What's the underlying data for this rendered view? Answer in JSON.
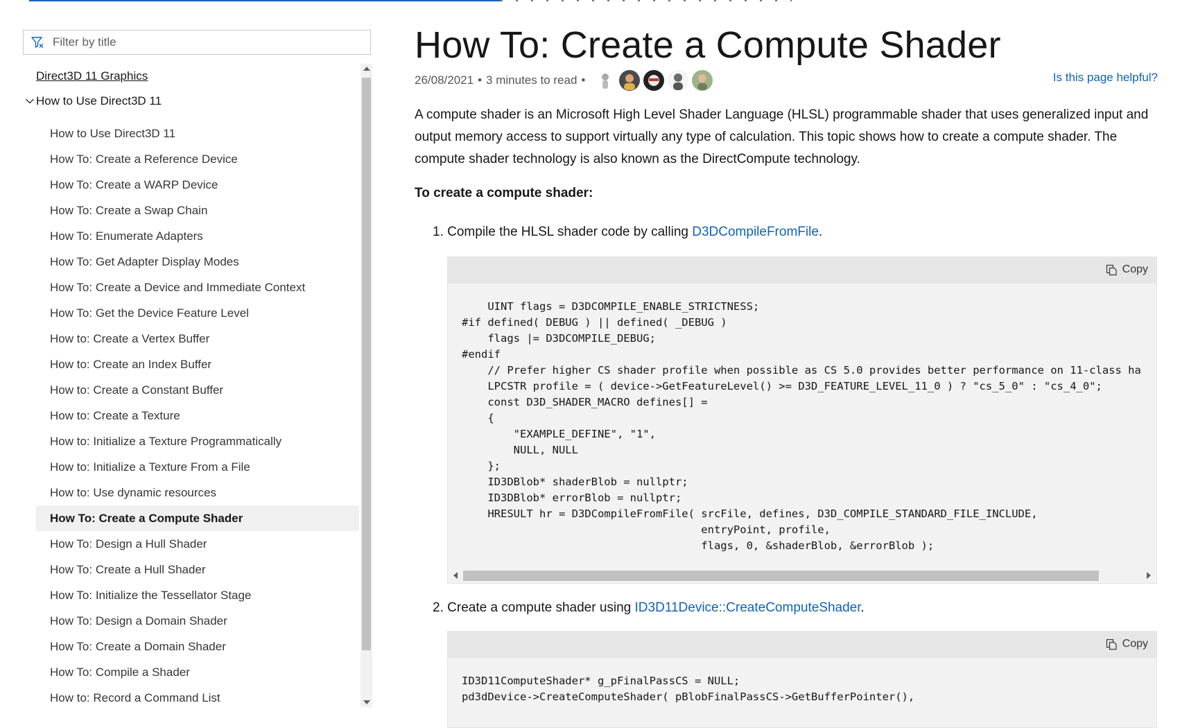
{
  "filter": {
    "placeholder": "Filter by title"
  },
  "toc": {
    "root": "Direct3D 11 Graphics",
    "group": "How to Use Direct3D 11",
    "items": [
      "How to Use Direct3D 11",
      "How To: Create a Reference Device",
      "How To: Create a WARP Device",
      "How To: Create a Swap Chain",
      "How To: Enumerate Adapters",
      "How To: Get Adapter Display Modes",
      "How To: Create a Device and Immediate Context",
      "How To: Get the Device Feature Level",
      "How to: Create a Vertex Buffer",
      "How to: Create an Index Buffer",
      "How to: Create a Constant Buffer",
      "How to: Create a Texture",
      "How to: Initialize a Texture Programmatically",
      "How to: Initialize a Texture From a File",
      "How to: Use dynamic resources",
      "How To: Create a Compute Shader",
      "How To: Design a Hull Shader",
      "How To: Create a Hull Shader",
      "How To: Initialize the Tessellator Stage",
      "How To: Design a Domain Shader",
      "How To: Create a Domain Shader",
      "How To: Compile a Shader",
      "How to: Record a Command List"
    ],
    "active_index": 15
  },
  "article": {
    "title": "How To: Create a Compute Shader",
    "date": "26/08/2021",
    "read_time": "3 minutes to read",
    "bullet": "•",
    "helpful": "Is this page helpful?",
    "intro": "A compute shader is an Microsoft High Level Shader Language (HLSL) programmable shader that uses generalized input and output memory access to support virtually any type of calculation. This topic shows how to create a compute shader. The compute shader technology is also known as the DirectCompute technology.",
    "procedure_heading": "To create a compute shader:",
    "steps": [
      {
        "number": "1.",
        "text": "Compile the HLSL shader code by calling ",
        "link": "D3DCompileFromFile",
        "after": "."
      },
      {
        "number": "2.",
        "text": "Create a compute shader using ",
        "link": "ID3D11Device::CreateComputeShader",
        "after": "."
      }
    ],
    "copy_label": "Copy",
    "code1": "    UINT flags = D3DCOMPILE_ENABLE_STRICTNESS;\n#if defined( DEBUG ) || defined( _DEBUG )\n    flags |= D3DCOMPILE_DEBUG;\n#endif\n    // Prefer higher CS shader profile when possible as CS 5.0 provides better performance on 11-class ha\n    LPCSTR profile = ( device->GetFeatureLevel() >= D3D_FEATURE_LEVEL_11_0 ) ? \"cs_5_0\" : \"cs_4_0\";\n    const D3D_SHADER_MACRO defines[] =\n    {\n        \"EXAMPLE_DEFINE\", \"1\",\n        NULL, NULL\n    };\n    ID3DBlob* shaderBlob = nullptr;\n    ID3DBlob* errorBlob = nullptr;\n    HRESULT hr = D3DCompileFromFile( srcFile, defines, D3D_COMPILE_STANDARD_FILE_INCLUDE,\n                                     entryPoint, profile,\n                                     flags, 0, &shaderBlob, &errorBlob );",
    "code2": "ID3D11ComputeShader* g_pFinalPassCS = NULL;\npd3dDevice->CreateComputeShader( pBlobFinalPassCS->GetBufferPointer(),"
  },
  "colors": {
    "link": "#0f62bb",
    "active_bg": "#f0f0f0",
    "code_bg": "#f2f2f2"
  }
}
